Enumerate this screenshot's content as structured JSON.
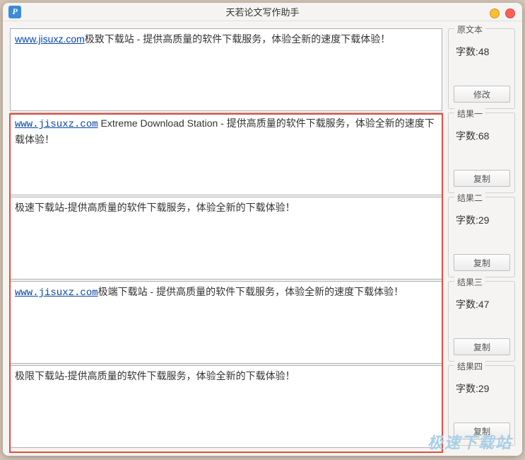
{
  "title": "天若论文写作助手",
  "app_icon_letter": "P",
  "watermark": "极速下载站",
  "word_count_label": "字数:",
  "panels": [
    {
      "title": "原文本",
      "count": "48",
      "button": "修改"
    },
    {
      "title": "结果一",
      "count": "68",
      "button": "复制"
    },
    {
      "title": "结果二",
      "count": "29",
      "button": "复制"
    },
    {
      "title": "结果三",
      "count": "47",
      "button": "复制"
    },
    {
      "title": "结果四",
      "count": "29",
      "button": "复制"
    }
  ],
  "boxes": [
    {
      "link": "www.jisuxz.com",
      "link_class": "",
      "text": "极致下载站 - 提供高质量的软件下载服务，体验全新的速度下载体验！"
    },
    {
      "link": "www.jisuxz.com",
      "link_class": "mono",
      "text": " Extreme Download Station  - 提供高质量的软件下载服务，体验全新的速度下载体验！"
    },
    {
      "link": "",
      "link_class": "",
      "text": "极速下载站-提供高质量的软件下载服务，体验全新的下载体验！"
    },
    {
      "link": "www.jisuxz.com",
      "link_class": "mono",
      "text": "极端下载站 - 提供高质量的软件下载服务，体验全新的速度下载体验！"
    },
    {
      "link": "",
      "link_class": "",
      "text": "极限下载站-提供高质量的软件下载服务，体验全新的下载体验！"
    }
  ]
}
